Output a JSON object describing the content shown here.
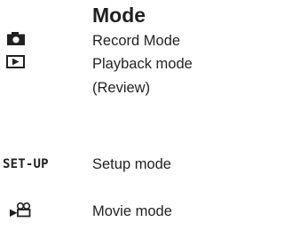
{
  "title": "Mode",
  "modes": [
    {
      "icon": "camera-icon",
      "label": "Record Mode"
    },
    {
      "icon": "playback-icon",
      "label": "Playback mode",
      "label_line2": "(Review)"
    },
    {
      "icon_text": "SET-UP",
      "label": "Setup mode"
    },
    {
      "icon": "movie-camera-icon",
      "label": "Movie mode"
    }
  ]
}
